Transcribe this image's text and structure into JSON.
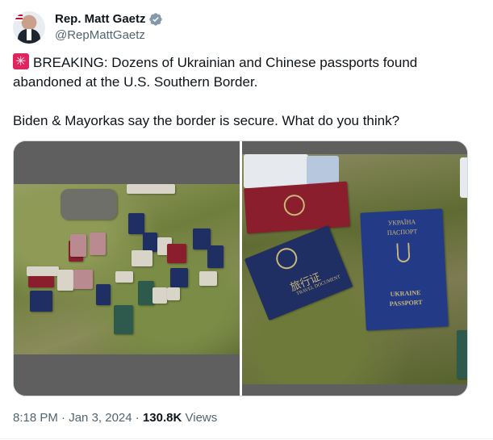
{
  "author": {
    "name": "Rep. Matt Gaetz",
    "handle": "@RepMattGaetz",
    "verified_color": "#829aab"
  },
  "tweet": {
    "line1": "BREAKING: Dozens of Ukrainian and Chinese passports found abandoned at the U.S. Southern Border.",
    "line2": "Biden & Mayorkas say the border is secure. What do you think?",
    "emoji_icon": "police-light-icon"
  },
  "media": {
    "left_photo": "passports-on-ground-photo",
    "right_photo": "passports-closeup-photo",
    "cn_cover_text": "旅行证",
    "cn_cover_sub": "TRAVEL DOCUMENT",
    "ua_cover_top": "УКРАЇНА",
    "ua_cover_top2": "ПАСПОРТ",
    "ua_cover_bottom": "UKRAINE",
    "ua_cover_bottom2": "PASSPORT"
  },
  "meta": {
    "time": "8:18 PM",
    "sep1": " · ",
    "date": "Jan 3, 2024",
    "sep2": " · ",
    "views_count": "130.8K",
    "views_label": " Views"
  },
  "colors": {
    "text": "#0f1419",
    "secondary": "#536471",
    "border": "#cfd9de"
  }
}
